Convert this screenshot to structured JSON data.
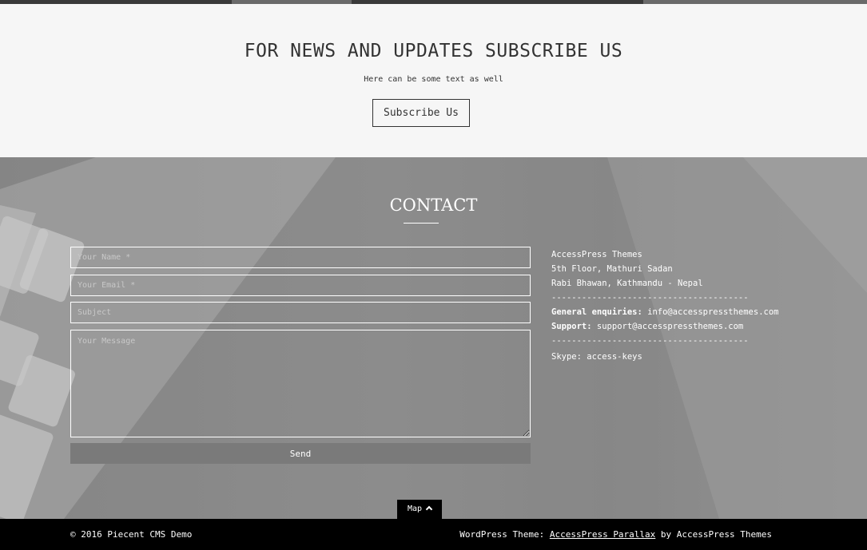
{
  "subscribe": {
    "title": "FOR NEWS AND UPDATES SUBSCRIBE US",
    "subtitle": "Here can be some text as well",
    "button_label": "Subscribe Us"
  },
  "contact": {
    "title": "CONTACT",
    "form": {
      "name_placeholder": "Your Name *",
      "email_placeholder": "Your Email *",
      "subject_placeholder": "Subject",
      "message_placeholder": "Your Message",
      "send_label": "Send"
    },
    "info": {
      "company": "AccessPress Themes",
      "address_line1": "5th Floor, Mathuri Sadan",
      "address_line2": "Rabi Bhawan, Kathmandu - Nepal",
      "divider": "---------------------------------------",
      "general_label": "General enquiries:",
      "general_email": "info@accesspressthemes.com",
      "support_label": "Support:",
      "support_email": "support@accesspressthemes.com",
      "skype": "Skype: access-keys"
    }
  },
  "map_tab": {
    "label": "Map"
  },
  "footer": {
    "copyright": "© 2016 Piecent CMS Demo",
    "theme_prefix": "WordPress Theme:",
    "theme_link": "AccessPress Parallax",
    "theme_suffix": "by AccessPress Themes"
  }
}
